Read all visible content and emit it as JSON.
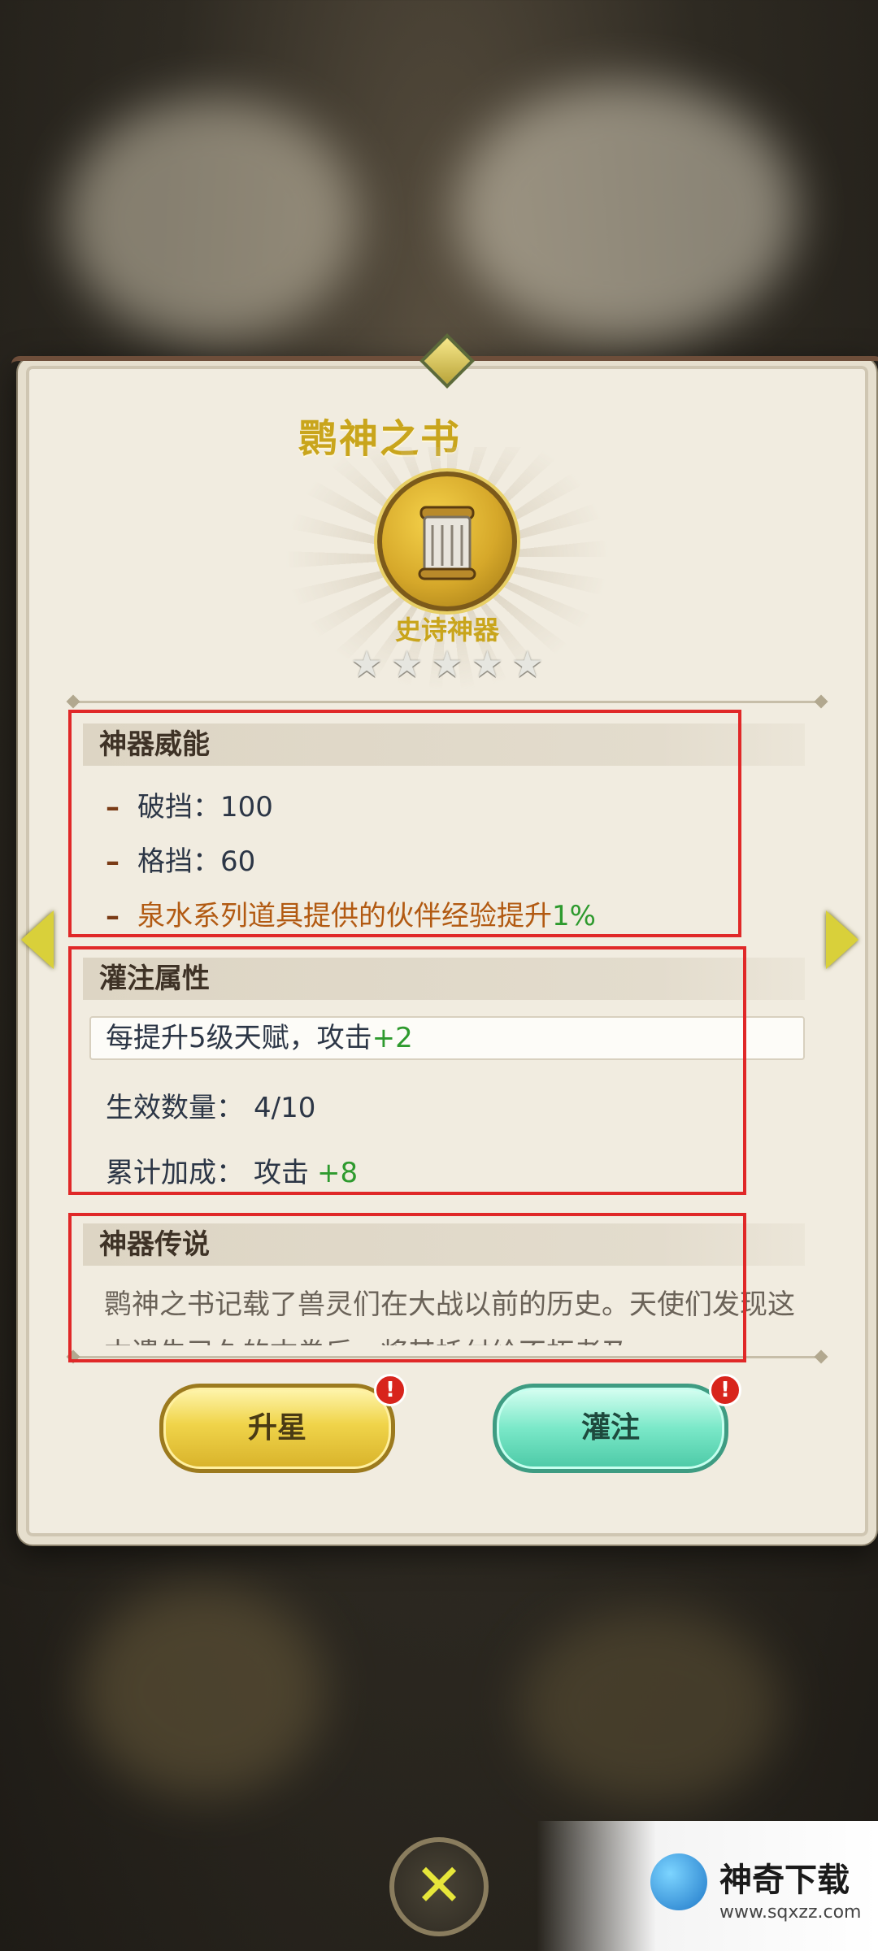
{
  "artifact": {
    "title": "鹮神之书",
    "rarity": "史诗神器",
    "stars_filled": 0,
    "stars_total": 5
  },
  "power": {
    "heading": "神器威能",
    "stats": [
      {
        "label": "破挡：",
        "value": "100"
      },
      {
        "label": "格挡：",
        "value": "60"
      },
      {
        "label": "泉水系列道具提供的伙伴经验提升",
        "value": "1%"
      }
    ]
  },
  "infusion": {
    "heading": "灌注属性",
    "rule_prefix": "每提升5级天赋，攻击",
    "rule_bonus": "+2",
    "count_label": "生效数量：",
    "count_value": "4/10",
    "total_label": "累计加成：",
    "total_stat": "攻击",
    "total_bonus": "+8"
  },
  "lore": {
    "heading": "神器传说",
    "text": "鹮神之书记载了兽灵们在大战以前的历史。天使们发现这本遗失已久的古卷后，将其托付给不朽者乃"
  },
  "buttons": {
    "upgrade": "升星",
    "infuse": "灌注",
    "badge": "!"
  },
  "nav": {
    "close": "✕"
  },
  "watermark": {
    "name": "神奇下载",
    "url": "www.sqxzz.com"
  },
  "colors": {
    "title_gold": "#c9a51c",
    "highlight_orange": "#b25a12",
    "bonus_green": "#2e9a2e",
    "annotation_red": "#e02828"
  }
}
